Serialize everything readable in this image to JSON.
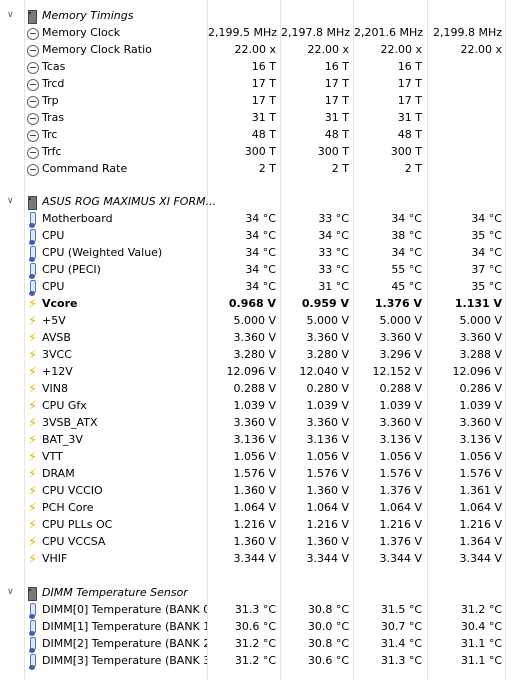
{
  "groups": [
    {
      "title": "Memory Timings",
      "icon": "memory-chip-icon",
      "items": [
        {
          "label": "Memory Clock",
          "icon": "clock-icon",
          "v": [
            "2,199.5 MHz",
            "2,197.8 MHz",
            "2,201.6 MHz",
            "2,199.8 MHz"
          ]
        },
        {
          "label": "Memory Clock Ratio",
          "icon": "clock-icon",
          "v": [
            "22.00 x",
            "22.00 x",
            "22.00 x",
            "22.00 x"
          ]
        },
        {
          "label": "Tcas",
          "icon": "clock-icon",
          "v": [
            "16 T",
            "16 T",
            "16 T",
            ""
          ]
        },
        {
          "label": "Trcd",
          "icon": "clock-icon",
          "v": [
            "17 T",
            "17 T",
            "17 T",
            ""
          ]
        },
        {
          "label": "Trp",
          "icon": "clock-icon",
          "v": [
            "17 T",
            "17 T",
            "17 T",
            ""
          ]
        },
        {
          "label": "Tras",
          "icon": "clock-icon",
          "v": [
            "31 T",
            "31 T",
            "31 T",
            ""
          ]
        },
        {
          "label": "Trc",
          "icon": "clock-icon",
          "v": [
            "48 T",
            "48 T",
            "48 T",
            ""
          ]
        },
        {
          "label": "Trfc",
          "icon": "clock-icon",
          "v": [
            "300 T",
            "300 T",
            "300 T",
            ""
          ]
        },
        {
          "label": "Command Rate",
          "icon": "clock-icon",
          "v": [
            "2 T",
            "2 T",
            "2 T",
            ""
          ]
        }
      ]
    },
    {
      "title": "ASUS ROG MAXIMUS XI FORM...",
      "icon": "motherboard-chip-icon",
      "items": [
        {
          "label": "Motherboard",
          "icon": "thermometer-icon",
          "v": [
            "34 °C",
            "33 °C",
            "34 °C",
            "34 °C"
          ]
        },
        {
          "label": "CPU",
          "icon": "thermometer-icon",
          "v": [
            "34 °C",
            "34 °C",
            "38 °C",
            "35 °C"
          ]
        },
        {
          "label": "CPU (Weighted Value)",
          "icon": "thermometer-icon",
          "v": [
            "34 °C",
            "33 °C",
            "34 °C",
            "34 °C"
          ]
        },
        {
          "label": "CPU (PECI)",
          "icon": "thermometer-icon",
          "v": [
            "34 °C",
            "33 °C",
            "55 °C",
            "37 °C"
          ]
        },
        {
          "label": "CPU",
          "icon": "thermometer-icon",
          "v": [
            "34 °C",
            "31 °C",
            "45 °C",
            "35 °C"
          ]
        },
        {
          "label": "Vcore",
          "icon": "voltage-bolt-icon",
          "bold": true,
          "v": [
            "0.968 V",
            "0.959 V",
            "1.376 V",
            "1.131 V"
          ]
        },
        {
          "label": "+5V",
          "icon": "voltage-bolt-icon",
          "v": [
            "5.000 V",
            "5.000 V",
            "5.000 V",
            "5.000 V"
          ]
        },
        {
          "label": "AVSB",
          "icon": "voltage-bolt-icon",
          "v": [
            "3.360 V",
            "3.360 V",
            "3.360 V",
            "3.360 V"
          ]
        },
        {
          "label": "3VCC",
          "icon": "voltage-bolt-icon",
          "v": [
            "3.280 V",
            "3.280 V",
            "3.296 V",
            "3.288 V"
          ]
        },
        {
          "label": "+12V",
          "icon": "voltage-bolt-icon",
          "v": [
            "12.096 V",
            "12.040 V",
            "12.152 V",
            "12.096 V"
          ]
        },
        {
          "label": "VIN8",
          "icon": "voltage-bolt-icon",
          "v": [
            "0.288 V",
            "0.280 V",
            "0.288 V",
            "0.286 V"
          ]
        },
        {
          "label": "CPU Gfx",
          "icon": "voltage-bolt-icon",
          "v": [
            "1.039 V",
            "1.039 V",
            "1.039 V",
            "1.039 V"
          ]
        },
        {
          "label": "3VSB_ATX",
          "icon": "voltage-bolt-icon",
          "v": [
            "3.360 V",
            "3.360 V",
            "3.360 V",
            "3.360 V"
          ]
        },
        {
          "label": "BAT_3V",
          "icon": "voltage-bolt-icon",
          "v": [
            "3.136 V",
            "3.136 V",
            "3.136 V",
            "3.136 V"
          ]
        },
        {
          "label": "VTT",
          "icon": "voltage-bolt-icon",
          "v": [
            "1.056 V",
            "1.056 V",
            "1.056 V",
            "1.056 V"
          ]
        },
        {
          "label": "DRAM",
          "icon": "voltage-bolt-icon",
          "v": [
            "1.576 V",
            "1.576 V",
            "1.576 V",
            "1.576 V"
          ]
        },
        {
          "label": "CPU VCCIO",
          "icon": "voltage-bolt-icon",
          "v": [
            "1.360 V",
            "1.360 V",
            "1.376 V",
            "1.361 V"
          ]
        },
        {
          "label": "PCH Core",
          "icon": "voltage-bolt-icon",
          "v": [
            "1.064 V",
            "1.064 V",
            "1.064 V",
            "1.064 V"
          ]
        },
        {
          "label": "CPU PLLs OC",
          "icon": "voltage-bolt-icon",
          "v": [
            "1.216 V",
            "1.216 V",
            "1.216 V",
            "1.216 V"
          ]
        },
        {
          "label": "CPU VCCSA",
          "icon": "voltage-bolt-icon",
          "v": [
            "1.360 V",
            "1.360 V",
            "1.376 V",
            "1.364 V"
          ]
        },
        {
          "label": "VHIF",
          "icon": "voltage-bolt-icon",
          "v": [
            "3.344 V",
            "3.344 V",
            "3.344 V",
            "3.344 V"
          ]
        }
      ]
    },
    {
      "title": "DIMM Temperature Sensor",
      "icon": "sensor-chip-icon",
      "items": [
        {
          "label": "DIMM[0] Temperature (BANK 0...",
          "icon": "thermometer-icon",
          "v": [
            "31.3 °C",
            "30.8 °C",
            "31.5 °C",
            "31.2 °C"
          ]
        },
        {
          "label": "DIMM[1] Temperature (BANK 1...",
          "icon": "thermometer-icon",
          "v": [
            "30.6 °C",
            "30.0 °C",
            "30.7 °C",
            "30.4 °C"
          ]
        },
        {
          "label": "DIMM[2] Temperature (BANK 2...",
          "icon": "thermometer-icon",
          "v": [
            "31.2 °C",
            "30.8 °C",
            "31.4 °C",
            "31.1 °C"
          ]
        },
        {
          "label": "DIMM[3] Temperature (BANK 3...",
          "icon": "thermometer-icon",
          "v": [
            "31.2 °C",
            "30.6 °C",
            "31.3 °C",
            "31.1 °C"
          ]
        }
      ]
    }
  ],
  "colors": {
    "grid": "#e6e6e6",
    "bolt": "#e8b800",
    "thermo": "#3b63b5"
  }
}
